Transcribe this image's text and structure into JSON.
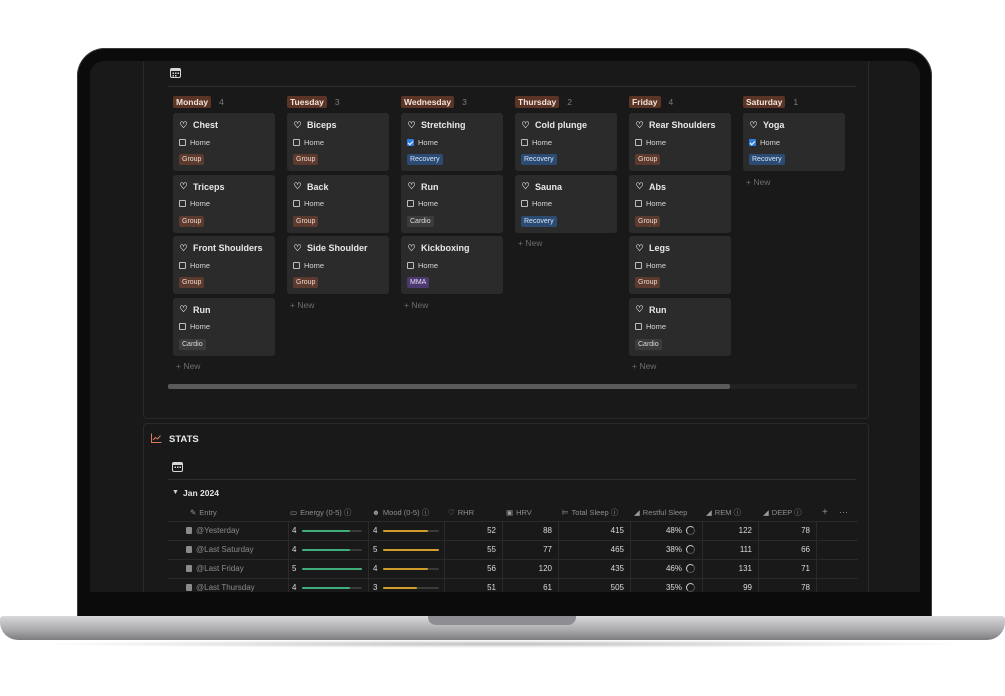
{
  "board": {
    "columns": [
      {
        "day": "Monday",
        "count": "4",
        "cards": [
          {
            "title": "Chest",
            "check_label": "Home",
            "checked": false,
            "tag": "Group",
            "tag_type": "group"
          },
          {
            "title": "Triceps",
            "check_label": "Home",
            "checked": false,
            "tag": "Group",
            "tag_type": "group"
          },
          {
            "title": "Front Shoulders",
            "check_label": "Home",
            "checked": false,
            "tag": "Group",
            "tag_type": "group"
          },
          {
            "title": "Run",
            "check_label": "Home",
            "checked": false,
            "tag": "Cardio",
            "tag_type": "cardio"
          }
        ]
      },
      {
        "day": "Tuesday",
        "count": "3",
        "cards": [
          {
            "title": "Biceps",
            "check_label": "Home",
            "checked": false,
            "tag": "Group",
            "tag_type": "group"
          },
          {
            "title": "Back",
            "check_label": "Home",
            "checked": false,
            "tag": "Group",
            "tag_type": "group"
          },
          {
            "title": "Side Shoulder",
            "check_label": "Home",
            "checked": false,
            "tag": "Group",
            "tag_type": "group"
          }
        ]
      },
      {
        "day": "Wednesday",
        "count": "3",
        "cards": [
          {
            "title": "Stretching",
            "check_label": "Home",
            "checked": true,
            "tag": "Recovery",
            "tag_type": "recovery"
          },
          {
            "title": "Run",
            "check_label": "Home",
            "checked": false,
            "tag": "Cardio",
            "tag_type": "cardio"
          },
          {
            "title": "Kickboxing",
            "check_label": "Home",
            "checked": false,
            "tag": "MMA",
            "tag_type": "mma"
          }
        ]
      },
      {
        "day": "Thursday",
        "count": "2",
        "cards": [
          {
            "title": "Cold plunge",
            "check_label": "Home",
            "checked": false,
            "tag": "Recovery",
            "tag_type": "recovery"
          },
          {
            "title": "Sauna",
            "check_label": "Home",
            "checked": false,
            "tag": "Recovery",
            "tag_type": "recovery"
          }
        ]
      },
      {
        "day": "Friday",
        "count": "4",
        "cards": [
          {
            "title": "Rear Shoulders",
            "check_label": "Home",
            "checked": false,
            "tag": "Group",
            "tag_type": "group"
          },
          {
            "title": "Abs",
            "check_label": "Home",
            "checked": false,
            "tag": "Group",
            "tag_type": "group"
          },
          {
            "title": "Legs",
            "check_label": "Home",
            "checked": false,
            "tag": "Group",
            "tag_type": "group"
          },
          {
            "title": "Run",
            "check_label": "Home",
            "checked": false,
            "tag": "Cardio",
            "tag_type": "cardio"
          }
        ]
      },
      {
        "day": "Saturday",
        "count": "1",
        "cards": [
          {
            "title": "Yoga",
            "check_label": "Home",
            "checked": true,
            "tag": "Recovery",
            "tag_type": "recovery"
          }
        ]
      }
    ],
    "new_label": "New"
  },
  "stats": {
    "title": "STATS",
    "group_label": "Jan 2024",
    "headers": {
      "entry": "Entry",
      "energy": "Energy (0-5)",
      "mood": "Mood (0-5)",
      "rhr": "RHR",
      "hrv": "HRV",
      "total_sleep": "Total Sleep",
      "restful_sleep": "Restful Sleep",
      "rem": "REM",
      "deep": "DEEP"
    },
    "rows": [
      {
        "entry": "@Yesterday",
        "energy": "4",
        "energy_frac": 0.8,
        "mood": "4",
        "mood_frac": 0.8,
        "rhr": "52",
        "hrv": "88",
        "total_sleep": "415",
        "restful": "48%",
        "rem": "122",
        "deep": "78"
      },
      {
        "entry": "@Last Saturday",
        "energy": "4",
        "energy_frac": 0.8,
        "mood": "5",
        "mood_frac": 1.0,
        "rhr": "55",
        "hrv": "77",
        "total_sleep": "465",
        "restful": "38%",
        "rem": "111",
        "deep": "66"
      },
      {
        "entry": "@Last Friday",
        "energy": "5",
        "energy_frac": 1.0,
        "mood": "4",
        "mood_frac": 0.8,
        "rhr": "56",
        "hrv": "120",
        "total_sleep": "435",
        "restful": "46%",
        "rem": "131",
        "deep": "71"
      },
      {
        "entry": "@Last Thursday",
        "energy": "4",
        "energy_frac": 0.8,
        "mood": "3",
        "mood_frac": 0.6,
        "rhr": "51",
        "hrv": "61",
        "total_sleep": "505",
        "restful": "35%",
        "rem": "99",
        "deep": "78"
      }
    ]
  },
  "colors": {
    "energy_bar": "#3fae7a",
    "mood_bar": "#d39a2c",
    "accent_blue": "#2f7de1"
  },
  "icons": {
    "board_view": "calendar-icon",
    "stats": "chart-line-icon",
    "card": "heart-rate-icon"
  }
}
